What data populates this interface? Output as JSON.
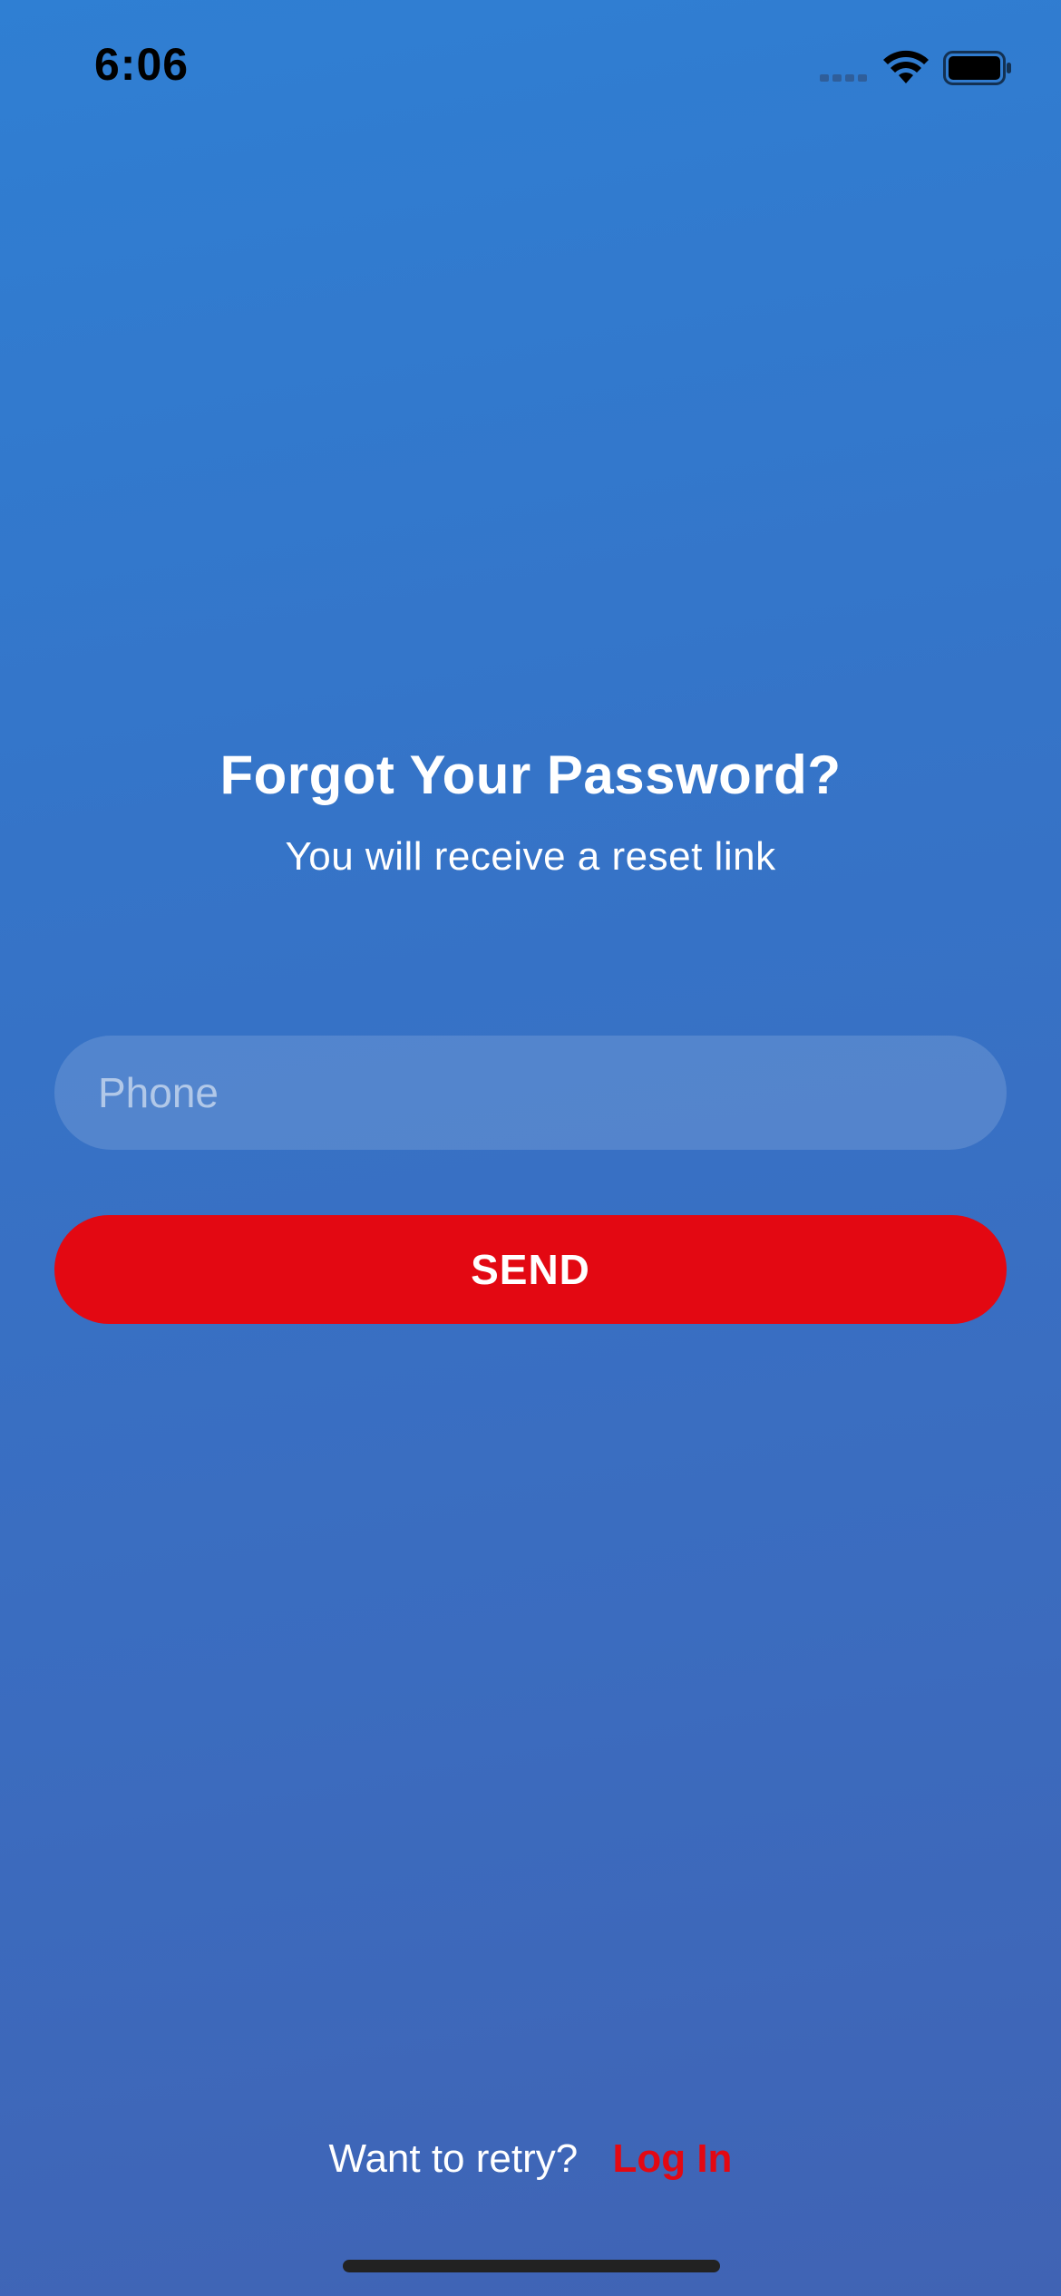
{
  "status_bar": {
    "time": "6:06",
    "icons": [
      "signal-icon",
      "wifi-icon",
      "battery-icon"
    ]
  },
  "header": {
    "title": "Forgot Your Password?",
    "subtitle": "You will receive a reset link"
  },
  "form": {
    "phone_placeholder": "Phone",
    "phone_value": "",
    "send_label": "SEND"
  },
  "footer": {
    "prompt": "Want to retry?",
    "login_label": "Log In"
  },
  "colors": {
    "background_top": "#2f7fd3",
    "background_bottom": "#4063b4",
    "accent_red": "#e30812",
    "text": "#ffffff"
  }
}
